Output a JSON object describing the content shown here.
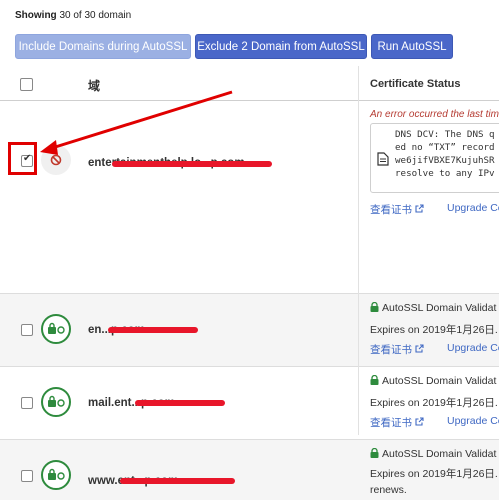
{
  "header": {
    "showing_label": "Showing",
    "showing_count": "30 of 30 domain"
  },
  "toolbar": {
    "include_label": "Include Domains during AutoSSL",
    "exclude_label": "Exclude 2 Domain from AutoSSL",
    "run_label": "Run AutoSSL"
  },
  "table": {
    "col_domain": "域",
    "col_status": "Certificate Status",
    "rows": [
      {
        "domain": "entertainmenthelp.lo...p.com",
        "error": "An error occurred the last tim",
        "dcv_lines": [
          "DNS DCV: The DNS q",
          "ed no “TXT” record",
          "we6jifVBXE7KujuhSR",
          "resolve to any IPv"
        ],
        "view_cert": "查看证书",
        "upgrade": "Upgrade Ce"
      },
      {
        "domain": "en...p.com",
        "status": "AutoSSL Domain Validat",
        "expires": "Expires on 2019年1月26日.",
        "view_cert": "查看证书",
        "upgrade": "Upgrade Ce"
      },
      {
        "domain": "mail.ent...p.com",
        "status": "AutoSSL Domain Validat",
        "expires": "Expires on 2019年1月26日.",
        "view_cert": "查看证书",
        "upgrade": "Upgrade Ce"
      },
      {
        "domain": "www.ent...p.com",
        "status": "AutoSSL Domain Validat",
        "expires": "Expires on 2019年1月26日.",
        "renews": "renews."
      }
    ]
  },
  "colors": {
    "accent": "#4a67c9",
    "error": "#b53b32",
    "success": "#2e8b3d",
    "annotation": "#e00000"
  }
}
